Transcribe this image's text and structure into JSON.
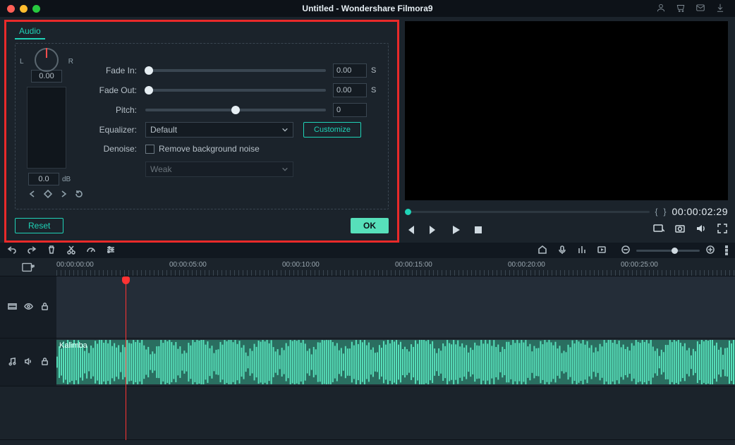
{
  "titlebar": {
    "title": "Untitled - Wondershare Filmora9"
  },
  "audio_panel": {
    "tab": "Audio",
    "balance_label_left": "L",
    "balance_label_right": "R",
    "balance_value": "0.00",
    "volume_value": "0.0",
    "volume_unit": "dB",
    "fields": {
      "fade_in_label": "Fade In:",
      "fade_in_value": "0.00",
      "fade_in_unit": "S",
      "fade_out_label": "Fade Out:",
      "fade_out_value": "0.00",
      "fade_out_unit": "S",
      "pitch_label": "Pitch:",
      "pitch_value": "0",
      "equalizer_label": "Equalizer:",
      "equalizer_value": "Default",
      "customize_btn": "Customize",
      "denoise_label": "Denoise:",
      "denoise_checkbox": "Remove background noise",
      "denoise_level": "Weak"
    },
    "buttons": {
      "reset": "Reset",
      "ok": "OK"
    }
  },
  "preview": {
    "timecode": "00:00:02:29"
  },
  "timeline": {
    "ticks": [
      "00:00:00:00",
      "00:00:05:00",
      "00:00:10:00",
      "00:00:15:00",
      "00:00:20:00",
      "00:00:25:00"
    ],
    "audio_clip_name": "Kalimba"
  }
}
